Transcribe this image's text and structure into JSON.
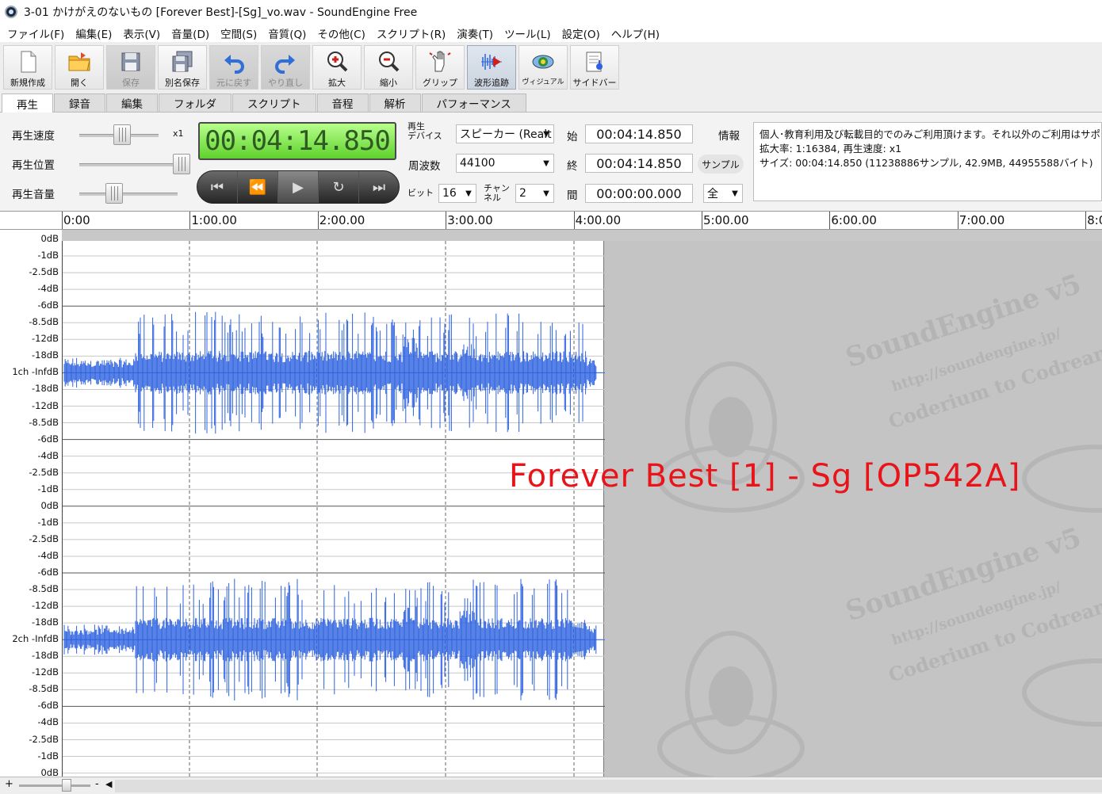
{
  "window": {
    "title": "3-01 かけがえのないもの [Forever Best]-[Sg]_vo.wav - SoundEngine Free"
  },
  "menu": [
    "ファイル(F)",
    "編集(E)",
    "表示(V)",
    "音量(D)",
    "空間(S)",
    "音質(Q)",
    "その他(C)",
    "スクリプト(R)",
    "演奏(T)",
    "ツール(L)",
    "設定(O)",
    "ヘルプ(H)"
  ],
  "toolbar": {
    "new": "新規作成",
    "open": "開く",
    "save": "保存",
    "save_as": "別名保存",
    "undo": "元に戻す",
    "redo": "やり直し",
    "zoom_in": "拡大",
    "zoom_out": "縮小",
    "grip": "グリップ",
    "wave_follow": "波形追跡",
    "visual": "ヴィジュアル",
    "sidebar": "サイドバー"
  },
  "tabs": [
    "再生",
    "録音",
    "編集",
    "フォルダ",
    "スクリプト",
    "音程",
    "解析",
    "パフォーマンス"
  ],
  "playback": {
    "speed_label": "再生速度",
    "speed_value": "x1",
    "position_label": "再生位置",
    "volume_label": "再生音量",
    "current_time": "00:04:14.850",
    "speed_level": 0.5,
    "position_level": 1.0,
    "volume_level": 0.4
  },
  "device": {
    "device_label_line1": "再生",
    "device_label_line2": "デバイス",
    "device_value": "スピーカー (Realt",
    "freq_label": "周波数",
    "freq_value": "44100",
    "bit_label": "ビット",
    "bit_value": "16",
    "channel_label_line1": "チャン",
    "channel_label_line2": "ネル",
    "channel_value": "2"
  },
  "range": {
    "start_label": "始",
    "start_value": "00:04:14.850",
    "end_label": "終",
    "end_value": "00:04:14.850",
    "length_label": "間",
    "length_value": "00:00:00.000",
    "info_label": "情報",
    "unit_badge": "サンプル",
    "scope_value": "全"
  },
  "info": {
    "line1": "個人･教育利用及び転載目的でのみご利用頂けます。それ以外のご利用はサポ",
    "line2": "拡大率: 1:16384, 再生速度: x1",
    "line3": "サイズ: 00:04:14.850 (11238886サンプル, 42.9MB, 44955588バイト)"
  },
  "timeline": {
    "ticks": [
      "0:00",
      "1:00.00",
      "2:00.00",
      "3:00.00",
      "4:00.00",
      "5:00.00",
      "6:00.00",
      "7:00.00",
      "8:0"
    ]
  },
  "db_scale": {
    "ch1": [
      "0dB",
      "-1dB",
      "-2.5dB",
      "-4dB",
      "-6dB",
      "-8.5dB",
      "-12dB",
      "-18dB",
      "1ch -InfdB",
      "-18dB",
      "-12dB",
      "-8.5dB",
      "-6dB",
      "-4dB",
      "-2.5dB",
      "-1dB",
      "0dB"
    ],
    "ch2": [
      "-1dB",
      "-2.5dB",
      "-4dB",
      "-6dB",
      "-8.5dB",
      "-12dB",
      "-18dB",
      "2ch -InfdB",
      "-18dB",
      "-12dB",
      "-8.5dB",
      "-6dB",
      "-4dB",
      "-2.5dB",
      "-1dB",
      "0dB"
    ]
  },
  "watermark": {
    "brand": "SoundEngine v5",
    "url": "http://soundengine.jp/",
    "company": "Coderium to Codream"
  },
  "overlay_title": "Forever Best [1] - Sg [OP542A]",
  "statusbar": {
    "zoom_plus": "+",
    "zoom_minus": "-",
    "scroll_left": "◀"
  },
  "colors": {
    "waveform": "#2e62e0",
    "lcd": "#7be94a",
    "overlay": "#e8141a"
  }
}
